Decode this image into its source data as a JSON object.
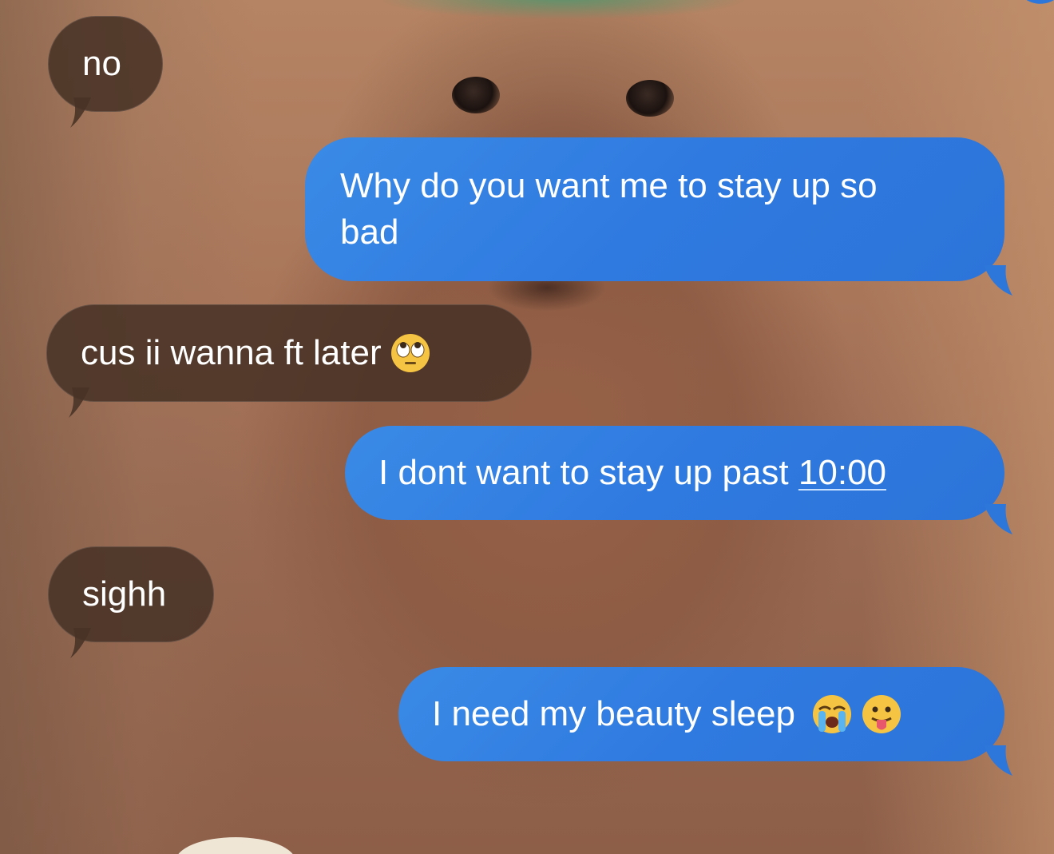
{
  "conversation": {
    "messages": [
      {
        "id": "m1",
        "direction": "incoming",
        "text": "no"
      },
      {
        "id": "m2",
        "direction": "outgoing",
        "line1": "Why do you want me to stay up so",
        "line2": "bad"
      },
      {
        "id": "m3",
        "direction": "incoming",
        "text": "cus ii wanna ft later",
        "emoji": "face-with-rolling-eyes"
      },
      {
        "id": "m4",
        "direction": "outgoing",
        "text_before": "I dont want to stay up past ",
        "time_link": "10:00"
      },
      {
        "id": "m5",
        "direction": "incoming",
        "text": "sighh"
      },
      {
        "id": "m6",
        "direction": "outgoing",
        "text": "I need my beauty sleep",
        "emojis": [
          "loudly-crying-face",
          "face-with-tongue"
        ]
      }
    ]
  },
  "colors": {
    "outgoing_bubble": "#2f7ae0",
    "incoming_bubble": "#48322680",
    "text": "#ffffff"
  }
}
